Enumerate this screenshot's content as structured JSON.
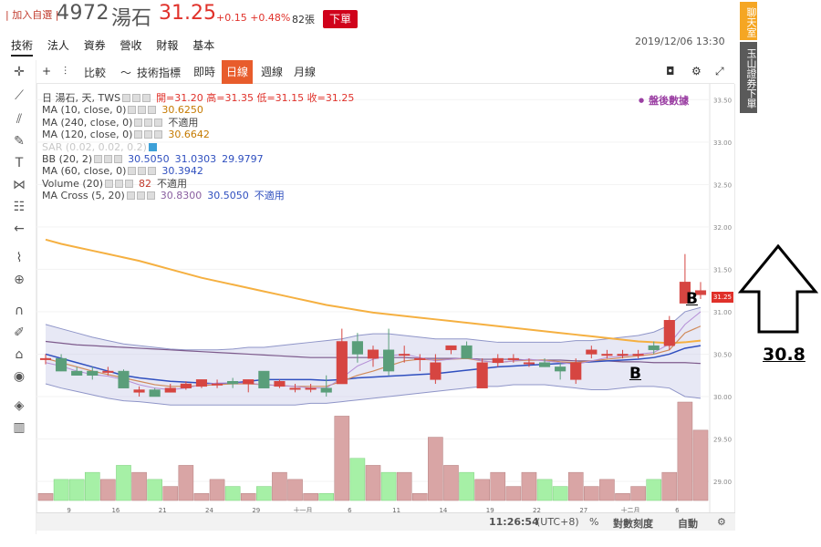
{
  "header": {
    "favorite": "| 加入自選 |",
    "code": "4972",
    "name": "湯石",
    "price": "31.25",
    "change": "+0.15 +0.48%",
    "volume": "82張",
    "order_button": "下單",
    "datetime": "2019/12/06 13:30"
  },
  "tabs": [
    "技術",
    "法人",
    "資券",
    "營收",
    "財報",
    "基本"
  ],
  "side_buttons": {
    "chat": "聊天室",
    "esun": "玉山證券下單"
  },
  "toolbar": {
    "compare": "比較",
    "indicators": "技術指標",
    "intraday": "即時",
    "daily": "日線",
    "weekly": "週線",
    "monthly": "月線"
  },
  "legend": {
    "symbol": "日 湯石, 天, TWS",
    "ohlc": "開=31.20  高=31.35  低=31.15  收=31.25",
    "ma10": "MA (10, close, 0)",
    "ma10_v": "30.6250",
    "ma240": "MA (240, close, 0)",
    "ma240_v": "不適用",
    "ma120": "MA (120, close, 0)",
    "ma120_v": "30.6642",
    "sar": "SAR (0.02, 0.02, 0.2)",
    "bb": "BB (20, 2)",
    "bb_v1": "30.5050",
    "bb_v2": "31.0303",
    "bb_v3": "29.9797",
    "ma60": "MA (60, close, 0)",
    "ma60_v": "30.3942",
    "vol": "Volume (20)",
    "vol_v1": "82",
    "vol_v2": "不適用",
    "mac": "MA Cross (5, 20)",
    "mac_v1": "30.8300",
    "mac_v2": "30.5050",
    "mac_v3": "不適用"
  },
  "after_hours": "盤後數據",
  "price_tag": "31.25",
  "status": {
    "time": "11:26:54",
    "tz": "(UTC+8)",
    "pct": "%",
    "log": "對數刻度",
    "auto": "自動"
  },
  "annotations": {
    "b1": "B",
    "b2": "B",
    "big_number": "30.8"
  },
  "colors": {
    "up": "#d64541",
    "down": "#5a9e7a",
    "ma_orange": "#f5b041",
    "ma_blue": "#2f4fbf",
    "ma_purple": "#7d5a8c",
    "band": "#c9cde8",
    "vol_up": "#d9a5a5",
    "vol_down": "#a6f0a6",
    "order": "#d0021b"
  },
  "chart_data": {
    "type": "candlestick",
    "ylim": [
      28.85,
      33.6
    ],
    "y_ticks": [
      "33.50",
      "33.00",
      "32.50",
      "32.00",
      "31.50",
      "31.00",
      "30.50",
      "30.00",
      "29.50",
      "29.00"
    ],
    "x_ticks": [
      "9",
      "16",
      "21",
      "24",
      "29",
      "十一月",
      "6",
      "11",
      "14",
      "19",
      "22",
      "27",
      "十二月",
      "6"
    ],
    "candles": [
      {
        "o": 30.45,
        "h": 30.5,
        "l": 30.38,
        "c": 30.45
      },
      {
        "o": 30.45,
        "h": 30.5,
        "l": 30.3,
        "c": 30.3
      },
      {
        "o": 30.3,
        "h": 30.35,
        "l": 30.25,
        "c": 30.25
      },
      {
        "o": 30.3,
        "h": 30.35,
        "l": 30.2,
        "c": 30.25
      },
      {
        "o": 30.3,
        "h": 30.35,
        "l": 30.25,
        "c": 30.3
      },
      {
        "o": 30.3,
        "h": 30.32,
        "l": 30.1,
        "c": 30.1
      },
      {
        "o": 30.05,
        "h": 30.12,
        "l": 30.0,
        "c": 30.08
      },
      {
        "o": 30.08,
        "h": 30.1,
        "l": 30.0,
        "c": 30.0
      },
      {
        "o": 30.05,
        "h": 30.15,
        "l": 30.05,
        "c": 30.1
      },
      {
        "o": 30.1,
        "h": 30.18,
        "l": 30.08,
        "c": 30.15
      },
      {
        "o": 30.12,
        "h": 30.2,
        "l": 30.1,
        "c": 30.2
      },
      {
        "o": 30.15,
        "h": 30.2,
        "l": 30.1,
        "c": 30.15
      },
      {
        "o": 30.18,
        "h": 30.22,
        "l": 30.1,
        "c": 30.15
      },
      {
        "o": 30.15,
        "h": 30.2,
        "l": 30.05,
        "c": 30.2
      },
      {
        "o": 30.3,
        "h": 30.3,
        "l": 30.1,
        "c": 30.1
      },
      {
        "o": 30.12,
        "h": 30.2,
        "l": 30.1,
        "c": 30.18
      },
      {
        "o": 30.1,
        "h": 30.15,
        "l": 30.05,
        "c": 30.1
      },
      {
        "o": 30.1,
        "h": 30.15,
        "l": 30.05,
        "c": 30.1
      },
      {
        "o": 30.1,
        "h": 30.25,
        "l": 30.0,
        "c": 30.05
      },
      {
        "o": 30.15,
        "h": 30.8,
        "l": 30.15,
        "c": 30.65
      },
      {
        "o": 30.65,
        "h": 30.75,
        "l": 30.4,
        "c": 30.5
      },
      {
        "o": 30.45,
        "h": 30.6,
        "l": 30.35,
        "c": 30.55
      },
      {
        "o": 30.55,
        "h": 30.8,
        "l": 30.25,
        "c": 30.3
      },
      {
        "o": 30.5,
        "h": 30.6,
        "l": 30.4,
        "c": 30.5
      },
      {
        "o": 30.45,
        "h": 30.5,
        "l": 30.3,
        "c": 30.45
      },
      {
        "o": 30.2,
        "h": 30.5,
        "l": 30.15,
        "c": 30.4
      },
      {
        "o": 30.55,
        "h": 30.6,
        "l": 30.5,
        "c": 30.6
      },
      {
        "o": 30.6,
        "h": 30.65,
        "l": 30.45,
        "c": 30.45
      },
      {
        "o": 30.1,
        "h": 30.45,
        "l": 30.1,
        "c": 30.4
      },
      {
        "o": 30.4,
        "h": 30.5,
        "l": 30.35,
        "c": 30.45
      },
      {
        "o": 30.45,
        "h": 30.5,
        "l": 30.4,
        "c": 30.45
      },
      {
        "o": 30.4,
        "h": 30.45,
        "l": 30.35,
        "c": 30.4
      },
      {
        "o": 30.4,
        "h": 30.45,
        "l": 30.35,
        "c": 30.35
      },
      {
        "o": 30.35,
        "h": 30.4,
        "l": 30.2,
        "c": 30.3
      },
      {
        "o": 30.2,
        "h": 30.45,
        "l": 30.15,
        "c": 30.4
      },
      {
        "o": 30.5,
        "h": 30.6,
        "l": 30.45,
        "c": 30.55
      },
      {
        "o": 30.5,
        "h": 30.55,
        "l": 30.45,
        "c": 30.5
      },
      {
        "o": 30.5,
        "h": 30.55,
        "l": 30.45,
        "c": 30.5
      },
      {
        "o": 30.5,
        "h": 30.55,
        "l": 30.45,
        "c": 30.5
      },
      {
        "o": 30.6,
        "h": 30.65,
        "l": 30.5,
        "c": 30.55
      },
      {
        "o": 30.6,
        "h": 30.95,
        "l": 30.55,
        "c": 30.9
      },
      {
        "o": 31.1,
        "h": 31.68,
        "l": 31.1,
        "c": 31.35
      },
      {
        "o": 31.2,
        "h": 31.35,
        "l": 31.15,
        "c": 31.25
      }
    ],
    "volume": [
      1,
      3,
      3,
      4,
      3,
      5,
      4,
      3,
      2,
      5,
      1,
      3,
      2,
      1,
      2,
      4,
      3,
      1,
      1,
      12,
      6,
      5,
      4,
      4,
      1,
      9,
      5,
      4,
      3,
      4,
      2,
      4,
      3,
      2,
      4,
      2,
      3,
      1,
      2,
      3,
      4,
      14,
      10
    ],
    "band_upper": [
      30.85,
      30.8,
      30.75,
      30.7,
      30.66,
      30.62,
      30.6,
      30.58,
      30.56,
      30.55,
      30.55,
      30.55,
      30.56,
      30.58,
      30.58,
      30.6,
      30.62,
      30.64,
      30.66,
      30.68,
      30.72,
      30.74,
      30.74,
      30.72,
      30.7,
      30.68,
      30.68,
      30.68,
      30.66,
      30.64,
      30.64,
      30.64,
      30.64,
      30.64,
      30.66,
      30.66,
      30.68,
      30.7,
      30.72,
      30.76,
      30.84,
      31.0,
      31.05
    ],
    "band_lower": [
      30.15,
      30.1,
      30.06,
      30.02,
      29.98,
      29.95,
      29.94,
      29.92,
      29.9,
      29.9,
      29.9,
      29.9,
      29.9,
      29.9,
      29.9,
      29.9,
      29.9,
      29.92,
      29.92,
      29.94,
      29.96,
      29.98,
      30.0,
      30.02,
      30.04,
      30.06,
      30.08,
      30.1,
      30.12,
      30.12,
      30.14,
      30.14,
      30.14,
      30.12,
      30.1,
      30.08,
      30.08,
      30.1,
      30.12,
      30.12,
      30.1,
      30.0,
      29.98
    ],
    "ma_orange": [
      31.85,
      31.8,
      31.76,
      31.72,
      31.68,
      31.64,
      31.6,
      31.55,
      31.5,
      31.45,
      31.4,
      31.36,
      31.32,
      31.28,
      31.24,
      31.2,
      31.16,
      31.12,
      31.08,
      31.05,
      31.02,
      30.99,
      30.97,
      30.95,
      30.93,
      30.91,
      30.89,
      30.87,
      30.85,
      30.83,
      30.81,
      30.79,
      30.77,
      30.75,
      30.73,
      30.71,
      30.69,
      30.67,
      30.65,
      30.64,
      30.63,
      30.64,
      30.66
    ],
    "ma_purple": [
      30.65,
      30.63,
      30.61,
      30.6,
      30.59,
      30.58,
      30.57,
      30.56,
      30.55,
      30.54,
      30.53,
      30.52,
      30.51,
      30.5,
      30.49,
      30.48,
      30.47,
      30.46,
      30.46,
      30.46,
      30.46,
      30.46,
      30.46,
      30.46,
      30.45,
      30.45,
      30.45,
      30.45,
      30.44,
      30.44,
      30.44,
      30.43,
      30.43,
      30.43,
      30.42,
      30.42,
      30.42,
      30.41,
      30.41,
      30.4,
      30.4,
      30.4,
      30.39
    ],
    "ma_blue": [
      30.5,
      30.45,
      30.4,
      30.35,
      30.3,
      30.25,
      30.22,
      30.2,
      30.18,
      30.17,
      30.16,
      30.15,
      30.16,
      30.18,
      30.2,
      30.2,
      30.2,
      30.2,
      30.19,
      30.2,
      30.22,
      30.23,
      30.24,
      30.25,
      30.26,
      30.27,
      30.29,
      30.31,
      30.33,
      30.35,
      30.36,
      30.37,
      30.38,
      30.39,
      30.4,
      30.41,
      30.42,
      30.43,
      30.44,
      30.46,
      30.5,
      30.57,
      30.6
    ],
    "ma_brown": [
      30.45,
      30.4,
      30.35,
      30.3,
      30.26,
      30.22,
      30.18,
      30.14,
      30.12,
      30.12,
      30.13,
      30.14,
      30.15,
      30.15,
      30.14,
      30.13,
      30.12,
      30.12,
      30.12,
      30.18,
      30.25,
      30.3,
      30.36,
      30.42,
      30.44,
      30.43,
      30.44,
      30.45,
      30.42,
      30.4,
      30.42,
      30.43,
      30.43,
      30.41,
      30.4,
      30.42,
      30.44,
      30.46,
      30.48,
      30.5,
      30.55,
      30.75,
      30.83
    ],
    "ma_violet": [
      30.4,
      30.36,
      30.3,
      30.26,
      30.24,
      30.2,
      30.14,
      30.1,
      30.08,
      30.1,
      30.14,
      30.16,
      30.16,
      30.16,
      30.14,
      30.13,
      30.12,
      30.1,
      30.1,
      30.22,
      30.36,
      30.44,
      30.48,
      30.5,
      30.46,
      30.42,
      30.44,
      30.46,
      30.42,
      30.4,
      30.42,
      30.44,
      30.42,
      30.4,
      30.38,
      30.42,
      30.46,
      30.48,
      30.5,
      30.52,
      30.62,
      30.85,
      31.0
    ]
  }
}
